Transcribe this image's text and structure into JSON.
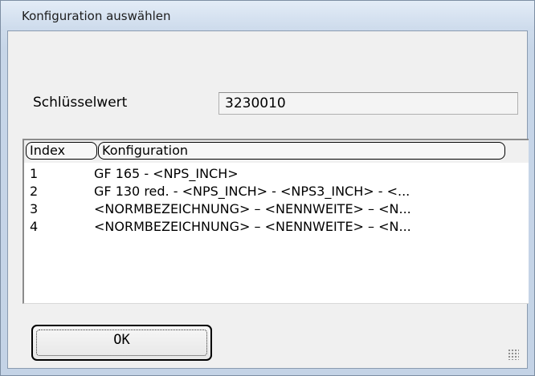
{
  "window": {
    "title": "Konfiguration auswählen"
  },
  "key": {
    "label": "Schlüsselwert",
    "value": "3230010"
  },
  "list": {
    "columns": [
      "Index",
      "Konfiguration"
    ],
    "rows": [
      {
        "index": "1",
        "config": "GF 165 - <NPS_INCH>"
      },
      {
        "index": "2",
        "config": "GF 130 red. - <NPS_INCH> - <NPS3_INCH> - <..."
      },
      {
        "index": "3",
        "config": "<NORMBEZEICHNUNG> – <NENNWEITE> – <N..."
      },
      {
        "index": "4",
        "config": "<NORMBEZEICHNUNG> – <NENNWEITE> – <N..."
      }
    ]
  },
  "buttons": {
    "ok_label": "OK"
  }
}
